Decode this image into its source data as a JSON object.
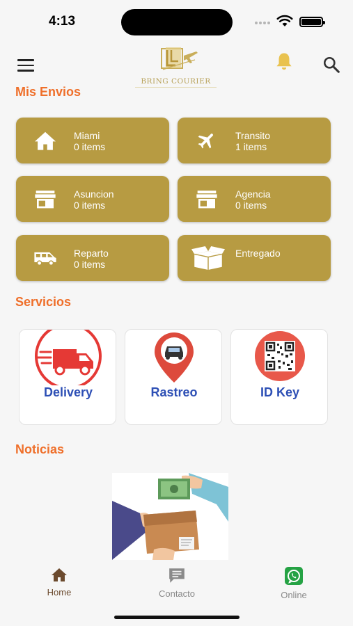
{
  "status": {
    "time": "4:13"
  },
  "header": {
    "logo_text": "BRING COURIER"
  },
  "sections": {
    "shipments_title": "Mis Envios",
    "services_title": "Servicios",
    "news_title": "Noticias"
  },
  "shipments": [
    {
      "label": "Miami",
      "count": "0 items",
      "icon": "home-icon"
    },
    {
      "label": "Transito",
      "count": "1 items",
      "icon": "airplane-icon"
    },
    {
      "label": "Asuncion",
      "count": "0 items",
      "icon": "store-icon"
    },
    {
      "label": "Agencia",
      "count": "0 items",
      "icon": "store-icon"
    },
    {
      "label": "Reparto",
      "count": "0 items",
      "icon": "van-icon"
    },
    {
      "label": "Entregado",
      "count": "",
      "icon": "open-box-icon"
    }
  ],
  "services": [
    {
      "label": "Delivery",
      "icon": "delivery-truck-icon"
    },
    {
      "label": "Rastreo",
      "icon": "map-pin-car-icon"
    },
    {
      "label": "ID Key",
      "icon": "qr-code-icon"
    }
  ],
  "bottom_nav": [
    {
      "label": "Home",
      "icon": "home-icon",
      "active": true
    },
    {
      "label": "Contacto",
      "icon": "chat-icon",
      "active": false
    },
    {
      "label": "Online",
      "icon": "whatsapp-icon",
      "active": false
    }
  ],
  "colors": {
    "accent": "#ef6f2a",
    "card_gold": "#b79b42",
    "service_blue": "#2d4fb5",
    "icon_red": "#e53935",
    "nav_active": "#6b4a2e",
    "nav_inactive": "#8a8a8a",
    "whatsapp_green": "#25a244"
  }
}
